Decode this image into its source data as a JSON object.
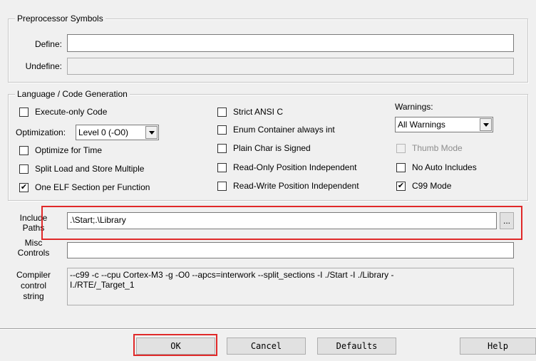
{
  "preprocessor": {
    "group_title": "Preprocessor Symbols",
    "define_label": "Define:",
    "define_value": "",
    "undefine_label": "Undefine:",
    "undefine_value": ""
  },
  "language": {
    "group_title": "Language / Code Generation",
    "execute_only": {
      "label": "Execute-only Code",
      "checked": false
    },
    "optimization_label": "Optimization:",
    "optimization_value": "Level 0 (-O0)",
    "optimize_time": {
      "label": "Optimize for Time",
      "checked": false
    },
    "split_load": {
      "label": "Split Load and Store Multiple",
      "checked": false
    },
    "one_elf": {
      "label": "One ELF Section per Function",
      "checked": true
    },
    "strict_ansi": {
      "label": "Strict ANSI C",
      "checked": false
    },
    "enum_container": {
      "label": "Enum Container always int",
      "checked": false
    },
    "plain_char": {
      "label": "Plain Char is Signed",
      "checked": false
    },
    "ro_pos": {
      "label": "Read-Only Position Independent",
      "checked": false
    },
    "rw_pos": {
      "label": "Read-Write Position Independent",
      "checked": false
    },
    "warnings_label": "Warnings:",
    "warnings_value": "All Warnings",
    "thumb_mode": {
      "label": "Thumb Mode",
      "checked": false,
      "disabled": true
    },
    "no_auto_includes": {
      "label": "No Auto Includes",
      "checked": false
    },
    "c99_mode": {
      "label": "C99 Mode",
      "checked": true
    }
  },
  "include": {
    "label_line1": "Include",
    "label_line2": "Paths",
    "value": ".\\Start;.\\Library",
    "browse_label": "..."
  },
  "misc": {
    "label_line1": "Misc",
    "label_line2": "Controls",
    "value": ""
  },
  "compiler": {
    "label_line1": "Compiler",
    "label_line2": "control",
    "label_line3": "string",
    "value": "--c99 -c --cpu Cortex-M3 -g -O0 --apcs=interwork --split_sections -I ./Start -I ./Library -I./RTE/_Target_1"
  },
  "buttons": {
    "ok": "OK",
    "cancel": "Cancel",
    "defaults": "Defaults",
    "help": "Help"
  },
  "colors": {
    "highlight": "#e02929"
  }
}
